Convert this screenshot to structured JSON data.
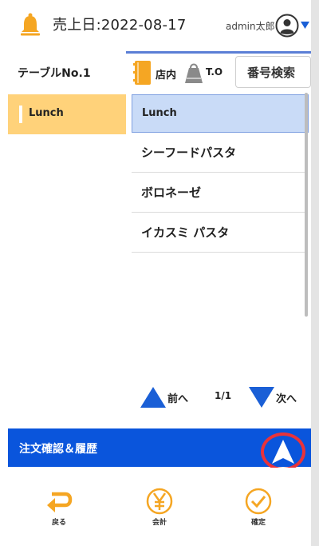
{
  "header": {
    "sales_date_label": "売上日:2022-08-17",
    "user_name": "admin太郎"
  },
  "table_tab": {
    "label": "テーブルNo.1"
  },
  "order_type": {
    "dine_in": "店内",
    "take_out": "T.O"
  },
  "search_button": "番号検索",
  "categories": [
    {
      "label": "Lunch",
      "selected": true
    }
  ],
  "menu": {
    "header": "Lunch",
    "items": [
      "シーフードパスタ",
      "ボロネーゼ",
      "イカスミ パスタ"
    ]
  },
  "pager": {
    "prev": "前へ",
    "page": "1/1",
    "next": "次へ"
  },
  "order_bar": {
    "label": "注文確認＆履歴"
  },
  "nav": {
    "back": "戻る",
    "checkout": "会計",
    "confirm": "確定"
  },
  "colors": {
    "accent_blue": "#0a55dc",
    "category_selected": "#ffd27a",
    "menu_header": "#c9dbf7",
    "nav_icon": "#f5a623",
    "highlight_circle": "#e9333a"
  },
  "icons": {
    "bell": "bell-icon",
    "avatar": "user-avatar-icon",
    "dine_in": "menu-book-icon",
    "take_out": "takeout-bag-icon",
    "prev": "triangle-up-icon",
    "next": "triangle-down-icon",
    "expand": "expand-up-icon",
    "back": "return-arrow-icon",
    "checkout": "yen-icon",
    "confirm": "check-circle-icon"
  }
}
